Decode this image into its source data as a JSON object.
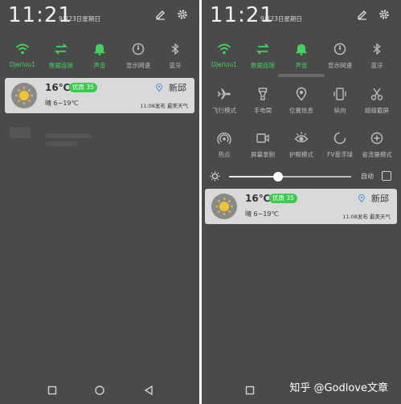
{
  "left": {
    "clock": "11:21",
    "date": "9月23日星期日",
    "quick_settings": [
      {
        "label": "DJerlou1",
        "icon": "wifi-icon",
        "on": true
      },
      {
        "label": "数据连接",
        "icon": "data-transfer-icon",
        "on": true
      },
      {
        "label": "声音",
        "icon": "bell-icon",
        "on": true
      },
      {
        "label": "显示网速",
        "icon": "speed-icon",
        "on": false
      },
      {
        "label": "蓝牙",
        "icon": "bluetooth-icon",
        "on": false
      }
    ],
    "weather": {
      "temp": "16℃",
      "aqi": "优质 35",
      "condition": "晴 6~19℃",
      "location": "新邱",
      "update": "11:08发布 最美天气"
    }
  },
  "right": {
    "clock": "11:21",
    "date": "9月23日星期日",
    "row1": [
      {
        "label": "DJerlou1",
        "icon": "wifi-icon",
        "on": true
      },
      {
        "label": "数据连接",
        "icon": "data-transfer-icon",
        "on": true
      },
      {
        "label": "声音",
        "icon": "bell-icon",
        "on": true
      },
      {
        "label": "显示网速",
        "icon": "speed-icon",
        "on": false
      },
      {
        "label": "蓝牙",
        "icon": "bluetooth-icon",
        "on": false
      }
    ],
    "row2": [
      {
        "label": "飞行模式",
        "icon": "airplane-icon",
        "on": false
      },
      {
        "label": "手电筒",
        "icon": "flashlight-icon",
        "on": false
      },
      {
        "label": "位置信息",
        "icon": "location-icon",
        "on": false
      },
      {
        "label": "纵向",
        "icon": "rotation-icon",
        "on": false
      },
      {
        "label": "超级截屏",
        "icon": "scissors-icon",
        "on": false
      }
    ],
    "row3": [
      {
        "label": "热点",
        "icon": "hotspot-icon",
        "on": false
      },
      {
        "label": "屏幕录制",
        "icon": "screen-record-icon",
        "on": false
      },
      {
        "label": "护眼模式",
        "icon": "eye-icon",
        "on": false
      },
      {
        "label": "FV悬浮球",
        "icon": "float-ball-icon",
        "on": false
      },
      {
        "label": "省流量模式",
        "icon": "data-saver-icon",
        "on": false
      }
    ],
    "brightness": {
      "level": 0.4,
      "auto_label": "自动",
      "auto_checked": false
    },
    "weather": {
      "temp": "16℃",
      "aqi": "优质 35",
      "condition": "晴 6~19℃",
      "location": "新邱",
      "update": "11:08发布 最美天气"
    }
  },
  "nav_buttons": [
    "recents-icon",
    "home-icon",
    "back-icon"
  ],
  "watermark": "知乎 @Godlove文章",
  "colors": {
    "accent_green": "#3fd65b",
    "badge_green": "#3cc94f",
    "panel_bg": "#4a4a4a",
    "card_bg": "#d9d9d9"
  }
}
